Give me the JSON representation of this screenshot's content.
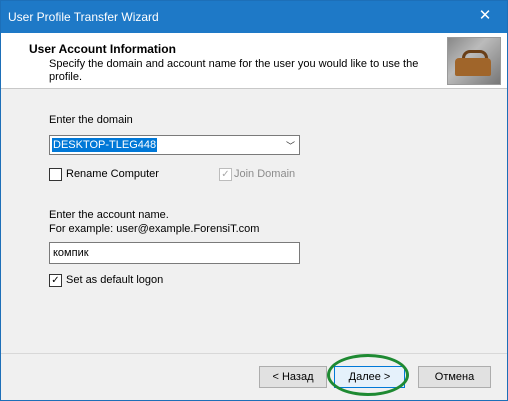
{
  "window": {
    "title": "User Profile Transfer Wizard",
    "close_glyph": "✕"
  },
  "header": {
    "title": "User Account  Information",
    "description": "Specify the domain and account name for the user you would like to use the profile."
  },
  "domain": {
    "label": "Enter the domain",
    "value": "DESKTOP-TLEG448"
  },
  "rename_computer": {
    "label": "Rename Computer",
    "checked": false
  },
  "join_domain": {
    "label": "Join Domain",
    "checked": true,
    "disabled": true
  },
  "account": {
    "label": "Enter the account name.",
    "example": "For example: user@example.ForensiT.com",
    "value": "компик"
  },
  "default_logon": {
    "label": "Set as default logon",
    "checked": true
  },
  "buttons": {
    "back": "< Назад",
    "next": "Далее >",
    "cancel": "Отмена"
  },
  "annotation": {
    "color": "#1e8a32"
  }
}
